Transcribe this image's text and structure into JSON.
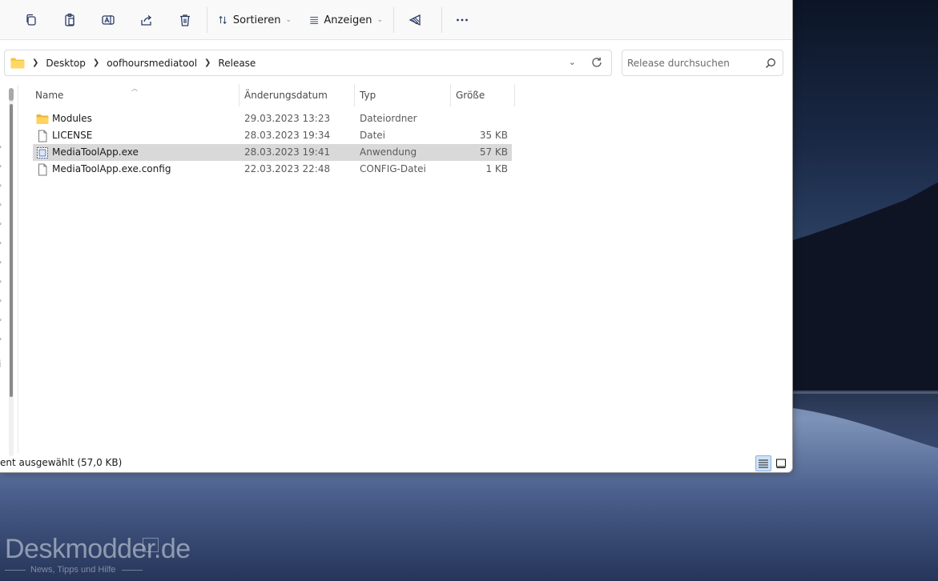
{
  "toolbar": {
    "sort_label": "Sortieren",
    "view_label": "Anzeigen"
  },
  "address": {
    "crumbs": [
      "Desktop",
      "oofhoursmediatool",
      "Release"
    ]
  },
  "search": {
    "placeholder": "Release durchsuchen"
  },
  "columns": {
    "name": "Name",
    "date": "Änderungsdatum",
    "type": "Typ",
    "size": "Größe"
  },
  "files": [
    {
      "name": "Modules",
      "date": "29.03.2023 13:23",
      "type": "Dateiordner",
      "size": "",
      "icon": "folder-icon",
      "selected": false
    },
    {
      "name": "LICENSE",
      "date": "28.03.2023 19:34",
      "type": "Datei",
      "size": "35 KB",
      "icon": "file-icon",
      "selected": false
    },
    {
      "name": "MediaToolApp.exe",
      "date": "28.03.2023 19:41",
      "type": "Anwendung",
      "size": "57 KB",
      "icon": "application-icon",
      "selected": true
    },
    {
      "name": "MediaToolApp.exe.config",
      "date": "22.03.2023 22:48",
      "type": "CONFIG-Datei",
      "size": "1 KB",
      "icon": "file-icon",
      "selected": false
    }
  ],
  "nav": {
    "clipped_letter": "i"
  },
  "status": {
    "text": "ent ausgewählt (57,0 KB)"
  },
  "watermark": {
    "logo": "Deskmodder.de",
    "tagline": "News, Tipps und Hilfe"
  },
  "colors": {
    "selection": "#d9d9d9",
    "folder": "#f4c542",
    "accent": "#1f2a44"
  }
}
